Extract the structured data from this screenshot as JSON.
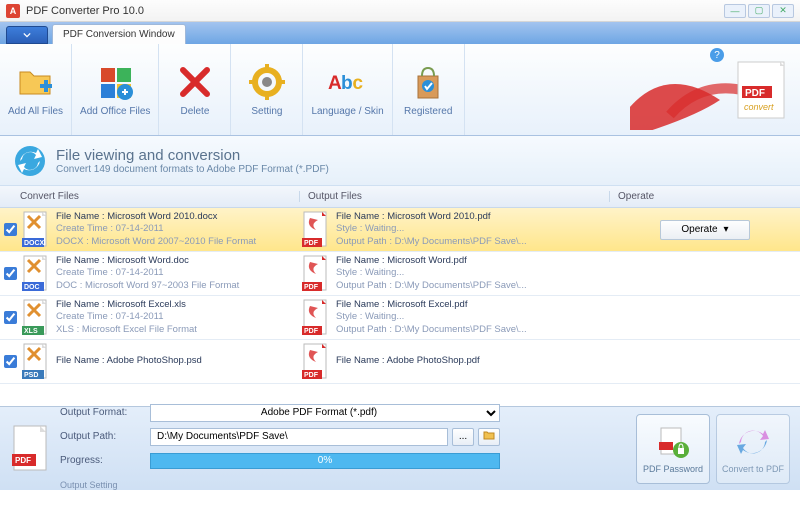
{
  "window": {
    "title": "PDF Converter Pro 10.0"
  },
  "tabs": {
    "main": "PDF Conversion Window"
  },
  "ribbon": {
    "add_all": "Add All Files",
    "add_office": "Add Office Files",
    "delete": "Delete",
    "setting": "Setting",
    "language": "Language / Skin",
    "registered": "Registered"
  },
  "section": {
    "title": "File viewing and conversion",
    "subtitle": "Convert 149 document formats to Adobe PDF Format (*.PDF)"
  },
  "columns": {
    "c1": "Convert Files",
    "c2": "Output Files",
    "c3": "Operate"
  },
  "operate_label": "Operate",
  "files": [
    {
      "selected": true,
      "badge": "DOCX",
      "in_name": "File Name : Microsoft Word 2010.docx",
      "in_meta1": "Create Time : 07-14-2011",
      "in_meta2": "DOCX : Microsoft Word 2007~2010 File Format",
      "out_name": "File Name : Microsoft Word 2010.pdf",
      "out_meta1": "Style : Waiting...",
      "out_meta2": "Output Path : D:\\My Documents\\PDF Save\\..."
    },
    {
      "selected": false,
      "badge": "DOC",
      "in_name": "File Name : Microsoft Word.doc",
      "in_meta1": "Create Time : 07-14-2011",
      "in_meta2": "DOC : Microsoft Word 97~2003 File Format",
      "out_name": "File Name : Microsoft Word.pdf",
      "out_meta1": "Style : Waiting...",
      "out_meta2": "Output Path : D:\\My Documents\\PDF Save\\..."
    },
    {
      "selected": false,
      "badge": "XLS",
      "in_name": "File Name : Microsoft Excel.xls",
      "in_meta1": "Create Time : 07-14-2011",
      "in_meta2": "XLS : Microsoft Excel File Format",
      "out_name": "File Name : Microsoft Excel.pdf",
      "out_meta1": "Style : Waiting...",
      "out_meta2": "Output Path : D:\\My Documents\\PDF Save\\..."
    },
    {
      "selected": false,
      "badge": "PSD",
      "in_name": "File Name : Adobe PhotoShop.psd",
      "in_meta1": "",
      "in_meta2": "",
      "out_name": "File Name : Adobe PhotoShop.pdf",
      "out_meta1": "",
      "out_meta2": ""
    }
  ],
  "footer": {
    "format_label": "Output Format:",
    "format_value": "Adobe PDF Format (*.pdf)",
    "path_label": "Output Path:",
    "path_value": "D:\\My Documents\\PDF Save\\",
    "progress_label": "Progress:",
    "progress_value": "0%",
    "output_setting": "Output Setting",
    "pdf_password": "PDF Password",
    "convert": "Convert to PDF",
    "browse": "..."
  }
}
